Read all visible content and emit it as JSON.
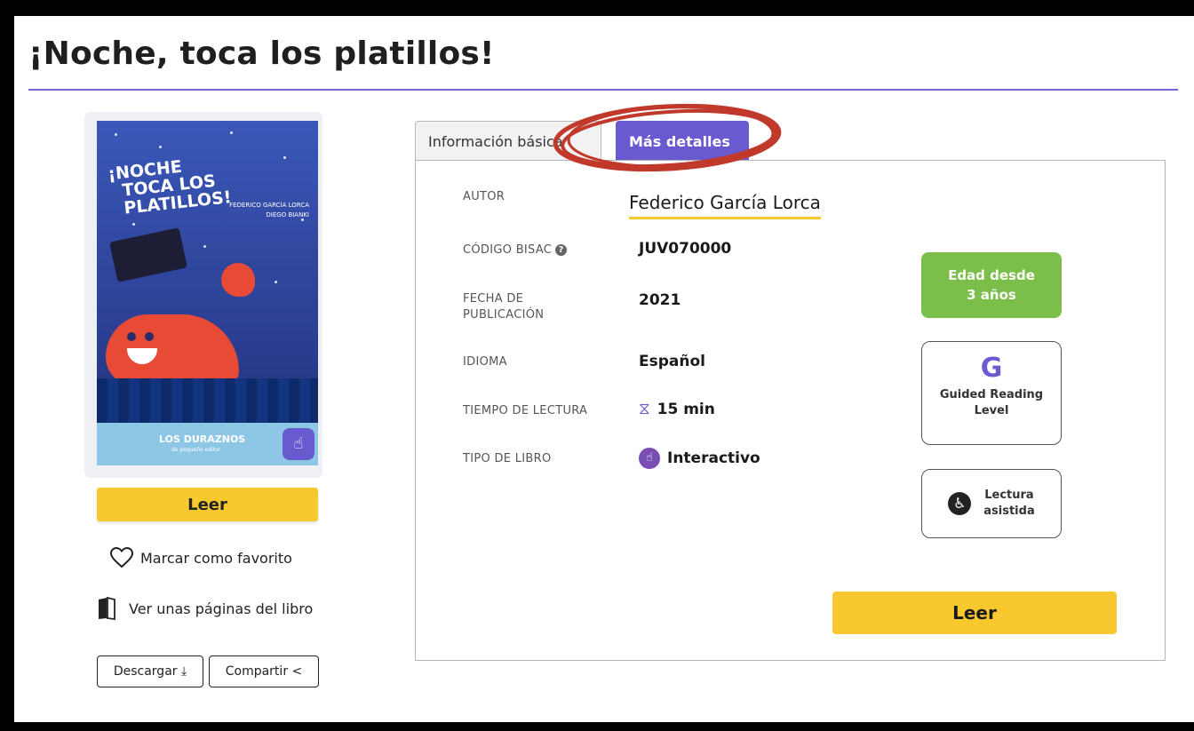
{
  "page": {
    "title": "¡Noche, toca los platillos!"
  },
  "cover": {
    "title_line1": "¡NOCHE",
    "title_line2": "TOCA LOS PLATILLOS!",
    "author_line1": "FEDERICO GARCÍA LORCA",
    "author_line2": "DIEGO BIANKI",
    "brand": "LOS DURAZNOS",
    "brand_sub": "de pequeño editor"
  },
  "sidebar": {
    "read_label": "Leer",
    "favorite_label": "Marcar como favorito",
    "preview_label": "Ver unas páginas del libro",
    "download_label": "Descargar ⤓",
    "share_label": "Compartir <"
  },
  "tabs": [
    {
      "label": "Información básica",
      "active": false
    },
    {
      "label": "Más detalles",
      "active": true
    }
  ],
  "details": {
    "author_label": "AUTOR",
    "author_value": "Federico García Lorca",
    "bisac_label": "CÓDIGO BISAC",
    "bisac_value": "JUV070000",
    "date_label_1": "FECHA DE",
    "date_label_2": "PUBLICACIÓN",
    "date_value": "2021",
    "language_label": "IDIOMA",
    "language_value": "Español",
    "time_label": "TIEMPO DE LECTURA",
    "time_value": "15 min",
    "type_label": "TIPO DE LIBRO",
    "type_value": "Interactivo"
  },
  "badges": {
    "age_line1": "Edad desde",
    "age_line2": "3 años",
    "guided_letter": "G",
    "guided_line1": "Guided Reading",
    "guided_line2": "Level",
    "assisted_line1": "Lectura",
    "assisted_line2": "asistida"
  },
  "main": {
    "read_label": "Leer"
  },
  "colors": {
    "accent": "#6a5ad0",
    "button": "#f7c92f",
    "age_badge": "#7bbf4a",
    "annotation": "#c0392b"
  }
}
